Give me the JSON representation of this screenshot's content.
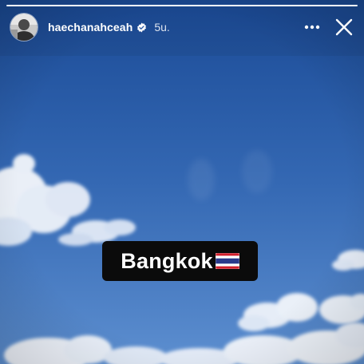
{
  "story": {
    "progress_fraction": 1.0,
    "username": "haechanahceah",
    "verified": true,
    "timestamp": "5u.",
    "sticker": {
      "text": "Bangkok",
      "flag": "thailand-flag-emoji"
    }
  },
  "icons": {
    "more": "more-horizontal-icon",
    "close": "close-icon",
    "verified": "verified-badge-icon"
  },
  "colors": {
    "sky_top": "#1d4f9c",
    "sky_bottom": "#5c8fd0",
    "sticker_bg": "#0b0b0b",
    "text": "#ffffff"
  }
}
